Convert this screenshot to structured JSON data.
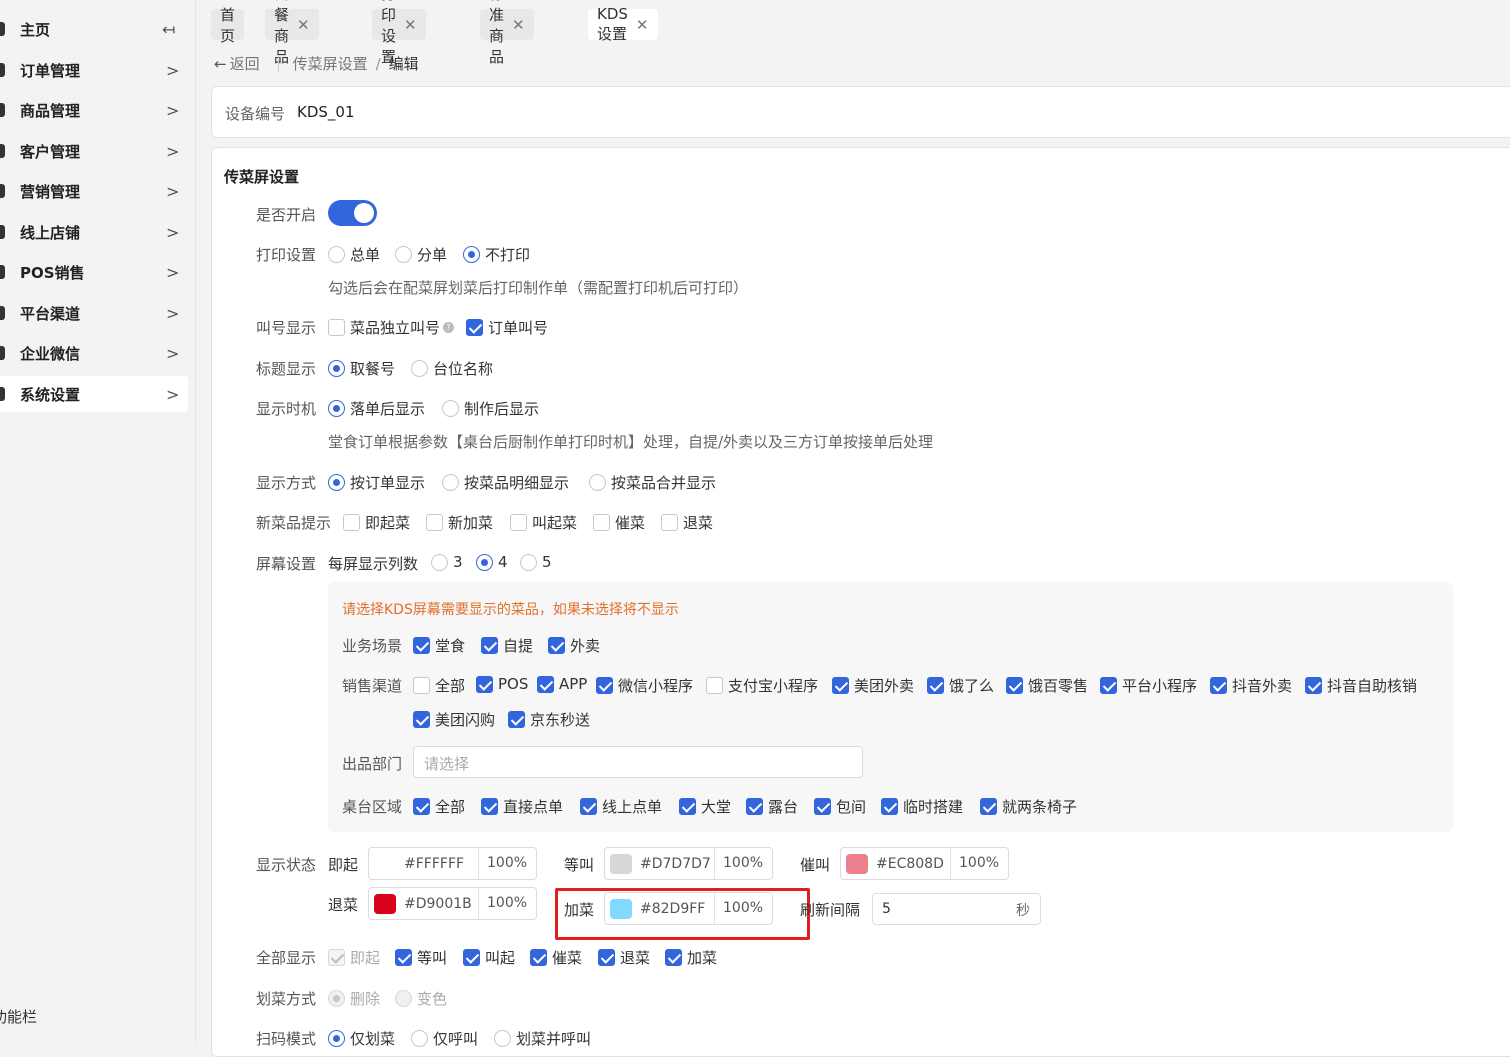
{
  "sidebar": {
    "items": [
      {
        "label": "主页"
      },
      {
        "label": "订单管理"
      },
      {
        "label": "商品管理"
      },
      {
        "label": "客户管理"
      },
      {
        "label": "营销管理"
      },
      {
        "label": "线上店铺"
      },
      {
        "label": "POS销售"
      },
      {
        "label": "平台渠道"
      },
      {
        "label": "企业微信"
      },
      {
        "label": "系统设置"
      }
    ],
    "footer": "功能栏"
  },
  "tabs": [
    {
      "label": "首页"
    },
    {
      "label": "套餐商品"
    },
    {
      "label": "打印设置"
    },
    {
      "label": "标准商品"
    },
    {
      "label": "KDS设置"
    }
  ],
  "breadcrumb": {
    "back": "返回",
    "parent": "传菜屏设置",
    "current": "编辑"
  },
  "device": {
    "label": "设备编号",
    "value": "KDS_01"
  },
  "section_title": "传菜屏设置",
  "enable": {
    "label": "是否开启",
    "on": true
  },
  "print": {
    "label": "打印设置",
    "options": [
      "总单",
      "分单",
      "不打印"
    ],
    "selected": "不打印",
    "hint": "勾选后会在配菜屏划菜后打印制作单（需配置打印机后可打印）"
  },
  "call": {
    "label": "叫号显示",
    "options": [
      "菜品独立叫号",
      "订单叫号"
    ],
    "qmark": "?"
  },
  "title_show": {
    "label": "标题显示",
    "options": [
      "取餐号",
      "台位名称"
    ]
  },
  "timing": {
    "label": "显示时机",
    "options": [
      "落单后显示",
      "制作后显示"
    ],
    "hint": "堂食订单根据参数【桌台后厨制作单打印时机】处理，自提/外卖以及三方订单按接单后处理"
  },
  "mode": {
    "label": "显示方式",
    "options": [
      "按订单显示",
      "按菜品明细显示",
      "按菜品合并显示"
    ]
  },
  "newtip": {
    "label": "新菜品提示",
    "options": [
      "即起菜",
      "新加菜",
      "叫起菜",
      "催菜",
      "退菜"
    ]
  },
  "screen": {
    "label": "屏幕设置",
    "sub": "每屏显示列数",
    "options": [
      "3",
      "4",
      "5"
    ],
    "selected": "4"
  },
  "panel": {
    "warning": "请选择KDS屏幕需要显示的菜品，如果未选择将不显示",
    "scene": {
      "label": "业务场景",
      "options": [
        "堂食",
        "自提",
        "外卖"
      ]
    },
    "channel": {
      "label": "销售渠道",
      "options": [
        "全部",
        "POS",
        "APP",
        "微信小程序",
        "支付宝小程序",
        "美团外卖",
        "饿了么",
        "饿百零售",
        "平台小程序",
        "抖音外卖",
        "抖音自助核销",
        "美团闪购",
        "京东秒送"
      ]
    },
    "dept": {
      "label": "出品部门",
      "placeholder": "请选择"
    },
    "area": {
      "label": "桌台区域",
      "options": [
        "全部",
        "直接点单",
        "线上点单",
        "大堂",
        "露台",
        "包间",
        "临时搭建",
        "就两条椅子"
      ]
    }
  },
  "status": {
    "label": "显示状态",
    "items": [
      {
        "name": "即起",
        "hex": "#FFFFFF",
        "pct": "100%",
        "color": "#FFFFFF"
      },
      {
        "name": "等叫",
        "hex": "#D7D7D7",
        "pct": "100%",
        "color": "#D7D7D7"
      },
      {
        "name": "催叫",
        "hex": "#EC808D",
        "pct": "100%",
        "color": "#EC808D"
      },
      {
        "name": "退菜",
        "hex": "#D9001B",
        "pct": "100%",
        "color": "#D9001B"
      },
      {
        "name": "加菜",
        "hex": "#82D9FF",
        "pct": "100%",
        "color": "#82D9FF"
      }
    ],
    "refresh": {
      "label": "刷新间隔",
      "value": "5",
      "unit": "秒"
    }
  },
  "all_show": {
    "label": "全部显示",
    "options": [
      "即起",
      "等叫",
      "叫起",
      "催菜",
      "退菜",
      "加菜"
    ]
  },
  "strike": {
    "label": "划菜方式",
    "options": [
      "删除",
      "变色"
    ]
  },
  "scan": {
    "label": "扫码模式",
    "options": [
      "仅划菜",
      "仅呼叫",
      "划菜并呼叫"
    ]
  },
  "colors": {
    "accent": "#3366DD",
    "warning": "#E0702A",
    "highlight": "#E02020"
  }
}
